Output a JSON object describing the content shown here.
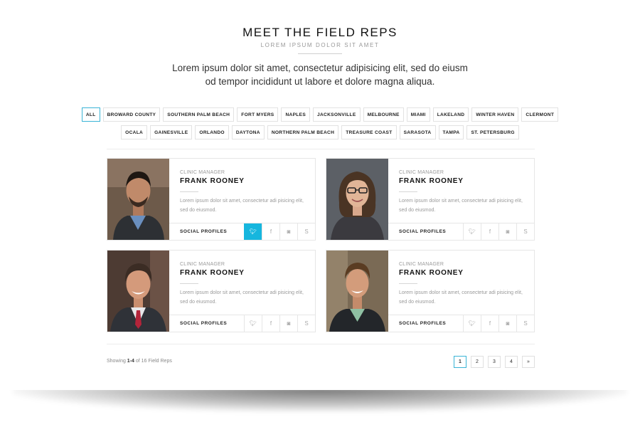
{
  "header": {
    "title": "MEET THE FIELD REPS",
    "subtitle": "LOREM IPSUM DOLOR SIT AMET",
    "intro_line1": "Lorem ipsum dolor sit amet, consectetur adipisicing elit, sed do eiusm",
    "intro_line2": "od tempor incididunt ut labore et dolore magna aliqua."
  },
  "filters": {
    "row1": [
      "ALL",
      "BROWARD COUNTY",
      "SOUTHERN PALM BEACH",
      "FORT MYERS",
      "NAPLES",
      "JACKSONVILLE",
      "MELBOURNE",
      "MIAMI",
      "LAKELAND",
      "WINTER HAVEN",
      "CLERMONT"
    ],
    "row2": [
      "OCALA",
      "GAINESVILLE",
      "ORLANDO",
      "DAYTONA",
      "NORTHERN PALM BEACH",
      "TREASURE COAST",
      "SARASOTA",
      "TAMPA",
      "ST. PETERSBURG"
    ],
    "active": "ALL",
    "accent": "#3ab4d6"
  },
  "reps": [
    {
      "role": "CLINIC MANAGER",
      "name": "FRANK ROONEY",
      "bio": "Lorem ipsum dolor sit amet, consectetur adi pisicing elit, sed do eiusmod.",
      "social_label": "SOCIAL PROFILES",
      "active_social": "twitter-icon"
    },
    {
      "role": "CLINIC MANAGER",
      "name": "FRANK ROONEY",
      "bio": "Lorem ipsum dolor sit amet, consectetur adi pisicing elit, sed do eiusmod.",
      "social_label": "SOCIAL PROFILES",
      "active_social": ""
    },
    {
      "role": "CLINIC MANAGER",
      "name": "FRANK ROONEY",
      "bio": "Lorem ipsum dolor sit amet, consectetur adi pisicing elit, sed do eiusmod.",
      "social_label": "SOCIAL PROFILES",
      "active_social": ""
    },
    {
      "role": "CLINIC MANAGER",
      "name": "FRANK ROONEY",
      "bio": "Lorem ipsum dolor sit amet, consectetur adi pisicing elit, sed do eiusmod.",
      "social_label": "SOCIAL PROFILES",
      "active_social": ""
    }
  ],
  "social_icons": [
    {
      "name": "twitter-icon",
      "glyph": "🐦︎"
    },
    {
      "name": "facebook-icon",
      "glyph": "f"
    },
    {
      "name": "instagram-icon",
      "glyph": "◙"
    },
    {
      "name": "skype-icon",
      "glyph": "S"
    }
  ],
  "social_active_color": "#16b6de",
  "footer": {
    "showing_prefix": "Showing ",
    "showing_range": "1-4",
    "showing_suffix": " of 16 Field Reps"
  },
  "pagination": {
    "pages": [
      "1",
      "2",
      "3",
      "4"
    ],
    "next": "»",
    "current": "1"
  }
}
